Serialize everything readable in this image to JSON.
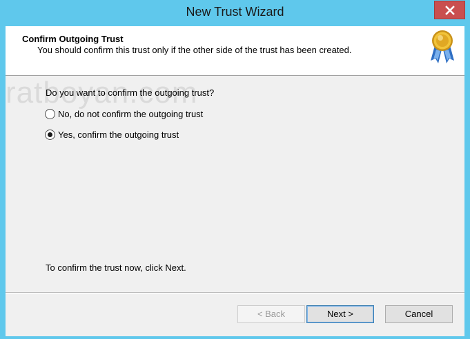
{
  "window": {
    "title": "New Trust Wizard",
    "close_icon": "close-icon"
  },
  "header": {
    "title": "Confirm Outgoing Trust",
    "subtitle": "You should confirm this trust only if the other side of the trust has been created.",
    "icon": "medal-icon"
  },
  "watermark": "ratboyan.com",
  "body": {
    "question": "Do you want to confirm the outgoing trust?",
    "options": [
      {
        "label": "No, do not confirm the outgoing trust",
        "selected": false
      },
      {
        "label": "Yes, confirm the outgoing trust",
        "selected": true
      }
    ],
    "hint": "To confirm the trust now, click Next."
  },
  "buttons": {
    "back": "< Back",
    "next": "Next >",
    "cancel": "Cancel"
  },
  "colors": {
    "title_bar": "#5fc8ec",
    "close_button": "#c94f4f",
    "dialog_background": "#f0f0f0"
  }
}
